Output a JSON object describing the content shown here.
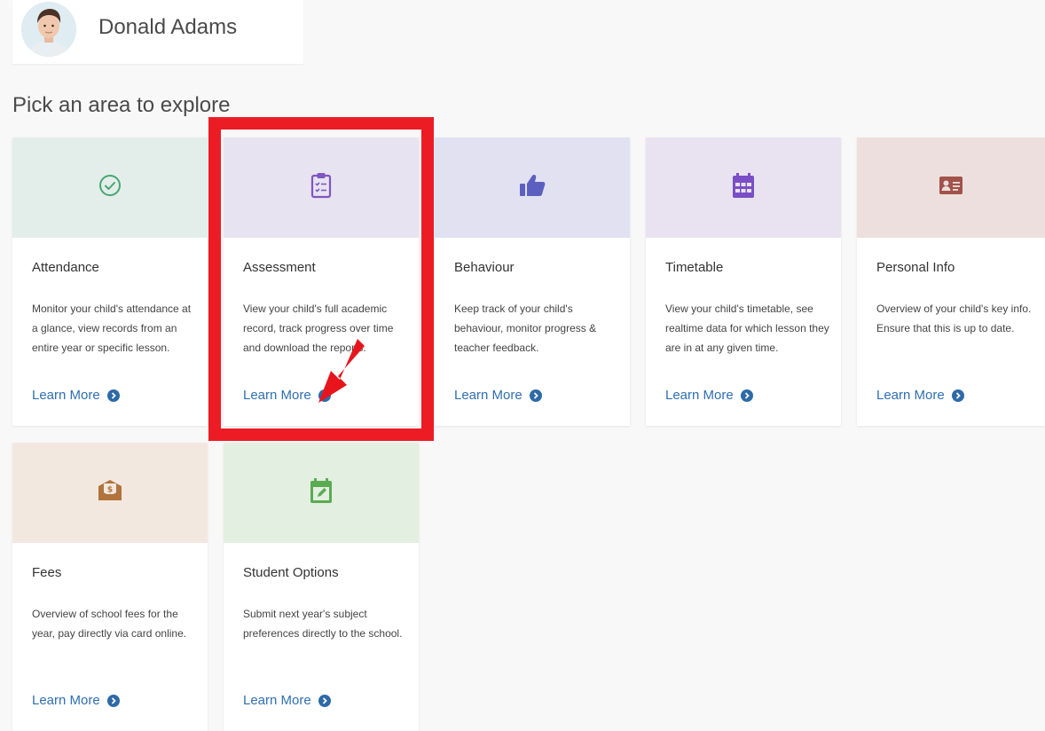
{
  "profile": {
    "name": "Donald Adams"
  },
  "section_title": "Pick an area to explore",
  "tiles": [
    {
      "title": "Attendance",
      "description": "Monitor your child's attendance at a glance, view records from an entire year or specific lesson.",
      "link": "Learn More",
      "icon": "check-circle-icon",
      "banner_color": "#e3eeea",
      "icon_color": "#47a771"
    },
    {
      "title": "Assessment",
      "description": "View your child's full academic record, track progress over time and download the reports.",
      "link": "Learn More",
      "icon": "clipboard-checklist-icon",
      "banner_color": "#e8e3f0",
      "icon_color": "#7e57c2"
    },
    {
      "title": "Behaviour",
      "description": "Keep track of your child's behaviour, monitor progress & teacher feedback.",
      "link": "Learn More",
      "icon": "thumbs-up-icon",
      "banner_color": "#e2e1f2",
      "icon_color": "#5b60c0"
    },
    {
      "title": "Timetable",
      "description": "View your child's timetable, see realtime data for which lesson they are in at any given time.",
      "link": "Learn More",
      "icon": "calendar-icon",
      "banner_color": "#e8e2f1",
      "icon_color": "#7a4ec4"
    },
    {
      "title": "Personal Info",
      "description": "Overview of your child's key info. Ensure that this is up to date.",
      "link": "Learn More",
      "icon": "id-card-icon",
      "banner_color": "#eddfdd",
      "icon_color": "#a1524a"
    },
    {
      "title": "Fees",
      "description": "Overview of school fees for the year, pay directly via card online.",
      "link": "Learn More",
      "icon": "money-envelope-icon",
      "banner_color": "#f3e8e0",
      "icon_color": "#b2733c"
    },
    {
      "title": "Student Options",
      "description": "Submit next year's subject preferences directly to the school.",
      "link": "Learn More",
      "icon": "calendar-edit-icon",
      "banner_color": "#e3efe0",
      "icon_color": "#5aab52"
    }
  ],
  "colors": {
    "highlight": "#ec1c24",
    "link": "#2f6fb2",
    "background": "#f8f8f8"
  }
}
